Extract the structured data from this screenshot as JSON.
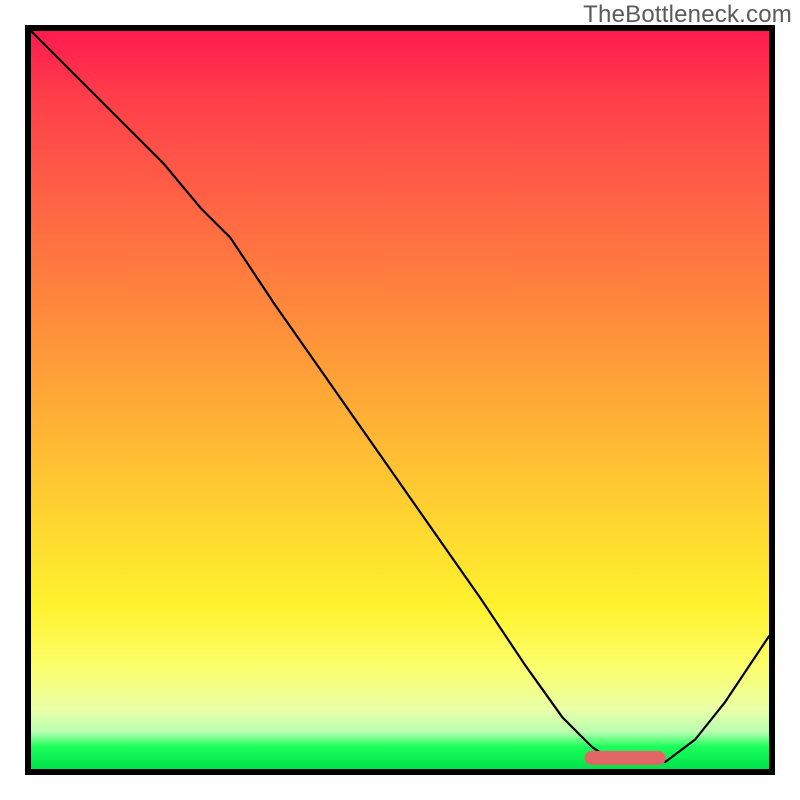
{
  "watermark": {
    "text": "TheBottleneck.com"
  },
  "chart_data": {
    "type": "line",
    "title": "",
    "xlabel": "",
    "ylabel": "",
    "xlim": [
      0,
      100
    ],
    "ylim": [
      0,
      100
    ],
    "grid": false,
    "legend": false,
    "background": {
      "kind": "vertical-gradient",
      "stops": [
        {
          "pos": 0,
          "color": "#ff1a4e"
        },
        {
          "pos": 18,
          "color": "#ff5647"
        },
        {
          "pos": 48,
          "color": "#ffa437"
        },
        {
          "pos": 78,
          "color": "#fff22e"
        },
        {
          "pos": 95,
          "color": "#b8ffb0"
        },
        {
          "pos": 100,
          "color": "#00e24a"
        }
      ]
    },
    "series": [
      {
        "name": "bottleneck-curve",
        "x": [
          0,
          6,
          12,
          18,
          23,
          27,
          33,
          40,
          47,
          54,
          61,
          67,
          72,
          76,
          79,
          82,
          86,
          90,
          94,
          100
        ],
        "y": [
          100,
          94,
          88,
          82,
          76,
          72,
          63,
          53,
          43,
          33,
          23,
          14,
          7,
          3,
          1,
          1,
          1,
          4,
          9,
          18
        ]
      }
    ],
    "marker": {
      "name": "optimal-range-pill",
      "shape": "rounded-rect",
      "x_range": [
        75,
        86
      ],
      "y": 1.5,
      "color": "#e36666"
    }
  }
}
